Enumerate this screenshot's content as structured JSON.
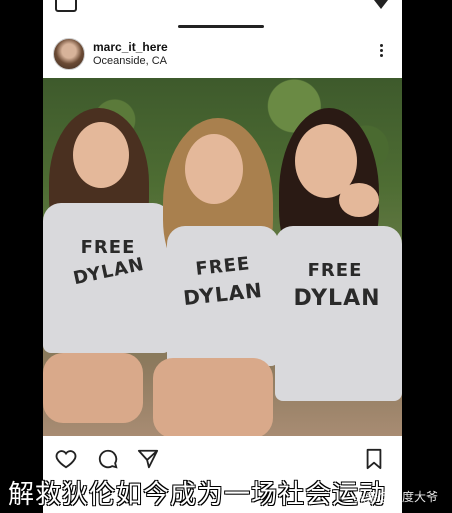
{
  "post": {
    "username": "marc_it_here",
    "location": "Oceanside, CA"
  },
  "photo": {
    "shirt_line1": "FREE",
    "shirt_line2": "DYLAN"
  },
  "caption": {
    "text": "解救狄伦如今成为一场社会运动"
  },
  "watermark": {
    "text": "头条@零度大爷"
  },
  "icons": {
    "more": "more-options-icon",
    "like": "heart-icon",
    "comment": "comment-icon",
    "share": "send-icon",
    "save": "bookmark-icon"
  }
}
